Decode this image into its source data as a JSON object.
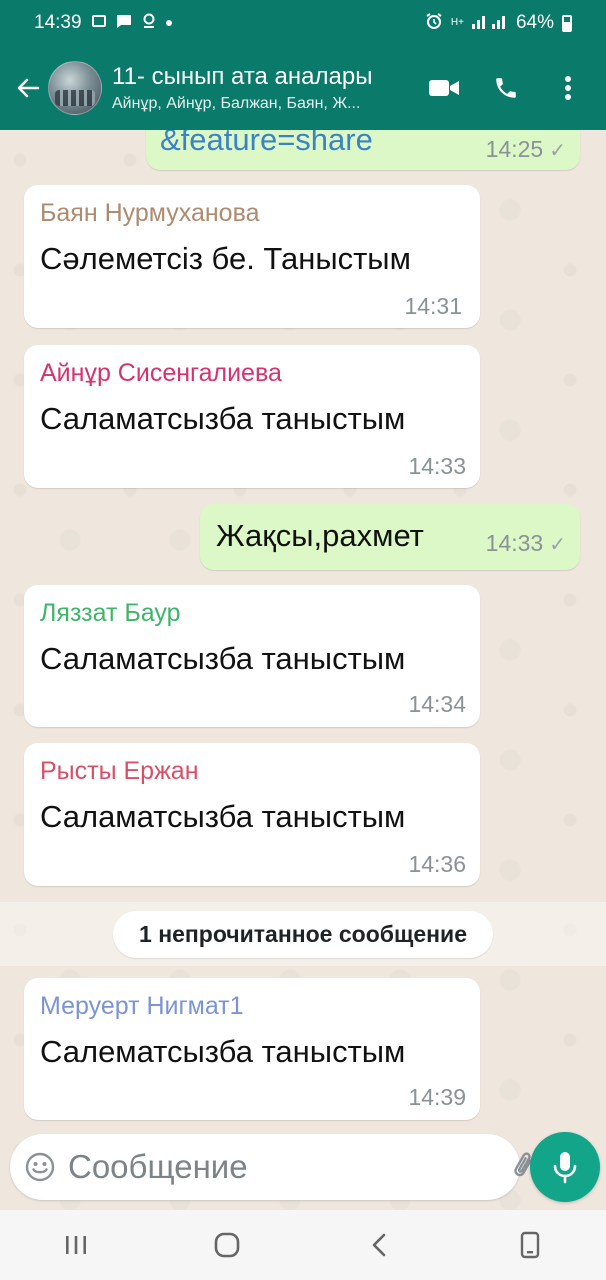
{
  "status_bar": {
    "time": "14:39",
    "network_label": "H+",
    "battery": "64%"
  },
  "chat": {
    "title": "11- сынып ата аналары",
    "subtitle": "Айнұр, Айнұр, Балжан, Баян, Ж..."
  },
  "messages": [
    {
      "type": "outgoing",
      "text": "&feature=share",
      "time": "14:25",
      "tick": "✓"
    },
    {
      "type": "incoming",
      "sender": "Баян Нурмуханова",
      "sender_color": "#b08a6e",
      "text": "Сәлеметсіз бе. Таныстым",
      "time": "14:31"
    },
    {
      "type": "incoming",
      "sender": "Айнұр Сисенгалиева",
      "sender_color": "#d8326e",
      "text": "Саламатсызба таныстым",
      "time": "14:33"
    },
    {
      "type": "outgoing",
      "text": "Жақсы,рахмет",
      "time": "14:33",
      "tick": "✓"
    },
    {
      "type": "incoming",
      "sender": "Ляззат Баур",
      "sender_color": "#3fb56a",
      "text": "Саламатсызба таныстым",
      "time": "14:34"
    },
    {
      "type": "incoming",
      "sender": "Рысты Ержан",
      "sender_color": "#d94f68",
      "text": "Саламатсызба таныстым",
      "time": "14:36"
    },
    {
      "type": "incoming",
      "sender": "Меруерт Нигмат1",
      "sender_color": "#7b94d6",
      "text": "Салематсызба  таныстым",
      "time": "14:39"
    }
  ],
  "unread_banner": "1 непрочитанное сообщение",
  "composer": {
    "placeholder": "Сообщение"
  },
  "colors": {
    "header": "#0a7a6a",
    "outgoing_bubble": "#dcf8c6",
    "mic_button": "#12a58a"
  }
}
